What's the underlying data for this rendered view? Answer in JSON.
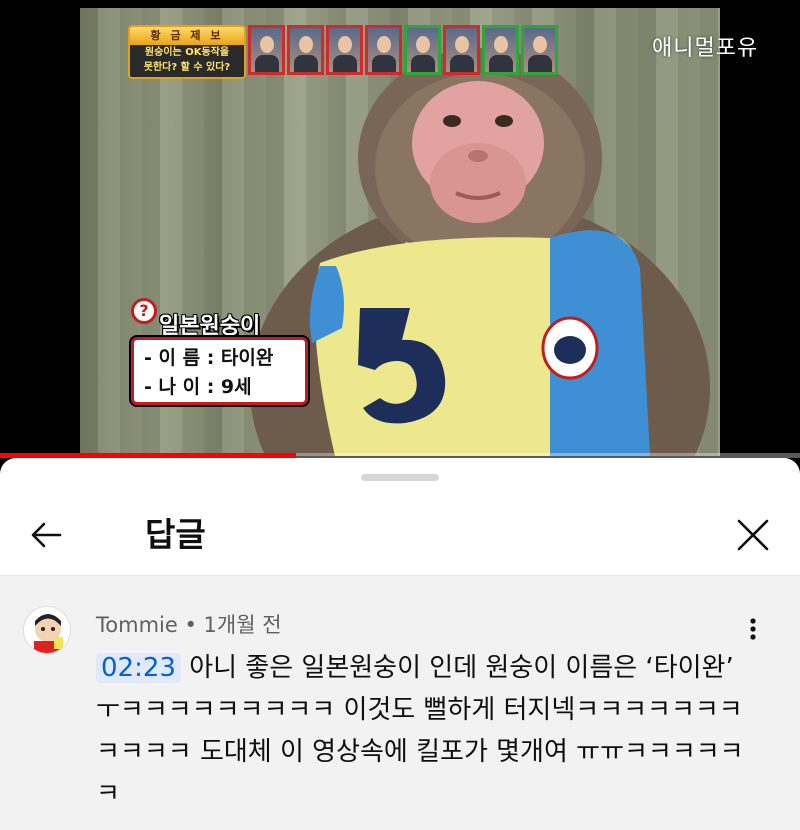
{
  "video": {
    "watermark": "애니멀포유",
    "program_title": "황 금 제 보",
    "program_question_line1": "원숭이는 OK동작을",
    "program_question_line2": "못한다? 할 수 있다?",
    "panel_borders": [
      "red",
      "red",
      "red",
      "red",
      "green",
      "red",
      "green",
      "green"
    ],
    "caption_icon": "?",
    "caption_name": "일본원숭이",
    "caption_line1": "- 이 름 : 타이완",
    "caption_line2": "- 나 이 : 9세",
    "jersey_number": "5",
    "progress_fraction": 0.37,
    "colors": {
      "progress": "#ff0000",
      "caption_border": "#c01f1f"
    }
  },
  "sheet": {
    "title": "답글",
    "back_icon": "arrow-left-icon",
    "close_icon": "close-icon"
  },
  "comment": {
    "author": "Tommie",
    "separator": " • ",
    "time": "1개월 전",
    "timestamp": "02:23",
    "text": " 아니 좋은 일본원숭이 인데 원숭이 이름은 ‘타이완’ ㅜㅋㅋㅋㅋㅋㅋㅋㅋㅋ 이것도 뻘하게 터지넥ㅋㅋㅋㅋㅋㅋㅋㅋㅋㅋㅋ 도대체 이 영상속에 킬포가 몇개여 ㅠㅠㅋㅋㅋㅋㅋㅋ",
    "more_icon": "more-vert-icon",
    "timestamp_color": "#065fd4"
  }
}
